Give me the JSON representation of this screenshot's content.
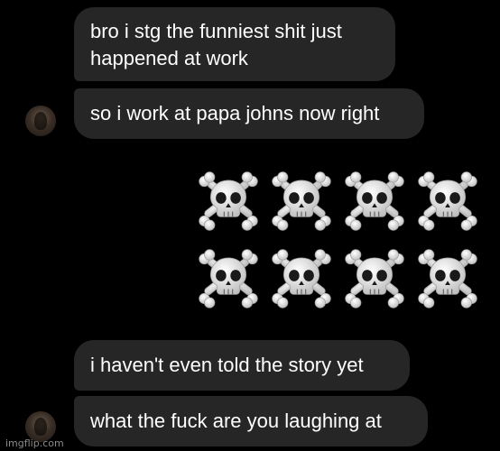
{
  "messages": [
    {
      "text": "bro i stg the funniest shit just\nhappened at work"
    },
    {
      "text": "so i work at papa johns now right"
    },
    {
      "text": "i haven't even told the story yet"
    },
    {
      "text": "what the fuck are you laughing at"
    }
  ],
  "reaction": {
    "emoji": "skull-and-crossbones",
    "count": 8
  },
  "watermark": "imgflip.com",
  "colors": {
    "background": "#000000",
    "bubble": "#262626",
    "text": "#ffffff"
  }
}
